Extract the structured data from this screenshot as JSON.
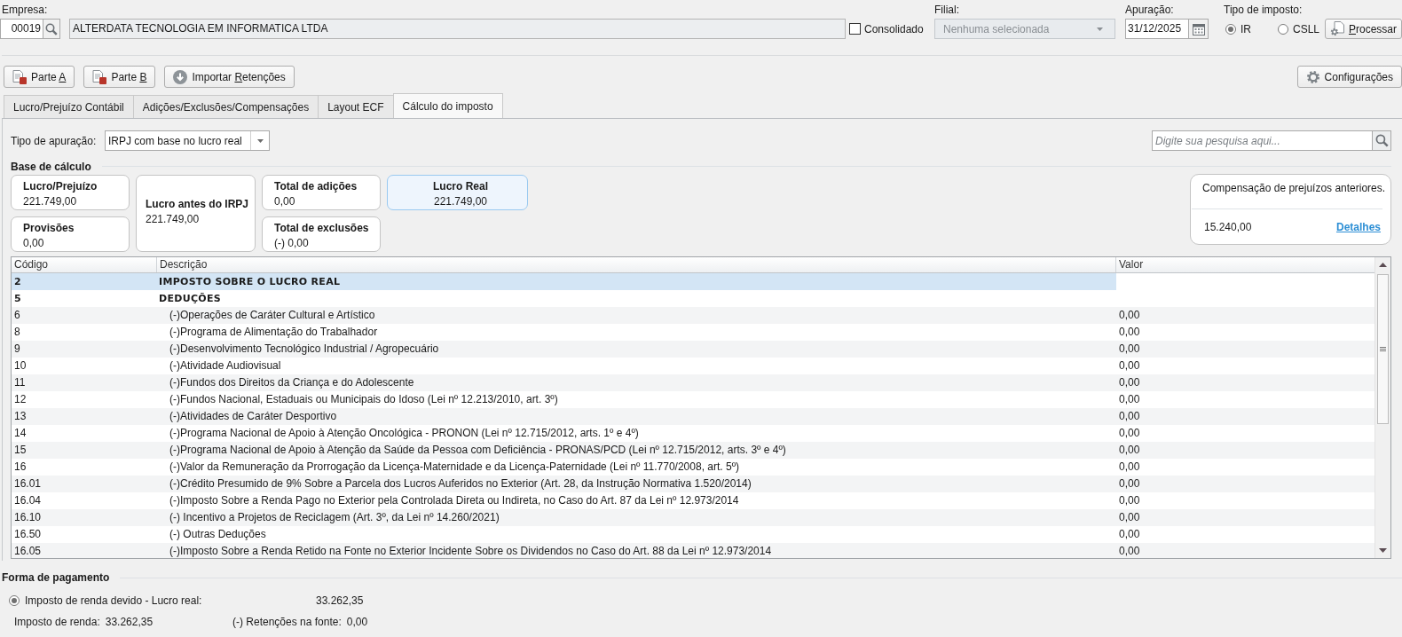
{
  "header": {
    "company": {
      "label": "Empresa:",
      "code": "00019",
      "name": "ALTERDATA TECNOLOGIA EM INFORMATICA LTDA"
    },
    "consolidated": {
      "label": "Consolidado",
      "checked": false
    },
    "branch": {
      "label": "Filial:",
      "value": "Nenhuma selecionada",
      "disabled": true
    },
    "period": {
      "label": "Apuração:",
      "value": "31/12/2025"
    },
    "tax_type": {
      "label": "Tipo de imposto:",
      "options": [
        {
          "label": "IR",
          "selected": true
        },
        {
          "label": "CSLL",
          "selected": false
        }
      ]
    },
    "process_button": {
      "mnemonic": "P",
      "post": "rocessar"
    }
  },
  "toolbar": {
    "buttons": [
      {
        "kind": "report",
        "pre": "Parte ",
        "mnemonic": "A"
      },
      {
        "kind": "report",
        "pre": "Parte ",
        "mnemonic": "B"
      },
      {
        "kind": "import",
        "pre": "Importar ",
        "mnemonic": "R",
        "post": "etenções"
      }
    ],
    "settings_button": {
      "label": "Configurações"
    }
  },
  "tabs": [
    {
      "label": "Lucro/Prejuízo Contábil",
      "selected": false
    },
    {
      "label": "Adições/Exclusões/Compensações",
      "selected": false
    },
    {
      "label": "Layout ECF",
      "selected": false
    },
    {
      "label": "Cálculo do imposto",
      "selected": true
    }
  ],
  "calculation": {
    "type_field": {
      "label": "Tipo de apuração:",
      "value": "IRPJ com base no lucro real"
    },
    "search": {
      "placeholder": "Digite sua pesquisa aqui..."
    },
    "base": {
      "title": "Base de cálculo",
      "cards": [
        {
          "kind": "normal",
          "label": "Lucro/Prejuízo",
          "value": "221.749,00"
        },
        {
          "kind": "normal",
          "label": "Provisões",
          "value": "0,00"
        },
        {
          "kind": "tall",
          "label": "Lucro antes do IRPJ",
          "value": "221.749,00"
        },
        {
          "kind": "normal",
          "label": "Total de adições",
          "value": "0,00"
        },
        {
          "kind": "normal",
          "label": "Total de exclusões",
          "value": "(-) 0,00"
        },
        {
          "kind": "featured",
          "label": "Lucro Real",
          "value": "221.749,00"
        }
      ],
      "compensation": {
        "title": "Compensação de prejuízos anteriores.",
        "value": "15.240,00",
        "link": "Detalhes"
      }
    },
    "table": {
      "columns": [
        "Código",
        "Descrição",
        "Valor"
      ],
      "rows": [
        {
          "code": "2",
          "description": "IMPOSTO SOBRE O LUCRO REAL",
          "selected": true
        },
        {
          "code": "5",
          "description": "DEDUÇÕES",
          "selected": false,
          "children": [
            {
              "code": "6",
              "description": "(-)Operações de Caráter Cultural e Artístico",
              "value": "0,00",
              "selected": false
            },
            {
              "code": "8",
              "description": "(-)Programa de Alimentação do Trabalhador",
              "value": "0,00",
              "selected": false
            },
            {
              "code": "9",
              "description": "(-)Desenvolvimento Tecnológico Industrial / Agropecuário",
              "value": "0,00",
              "selected": false
            },
            {
              "code": "10",
              "description": "(-)Atividade Audiovisual",
              "value": "0,00",
              "selected": false
            },
            {
              "code": "11",
              "description": "(-)Fundos dos Direitos da Criança e do Adolescente",
              "value": "0,00",
              "selected": false
            },
            {
              "code": "12",
              "description": "(-)Fundos Nacional, Estaduais ou Municipais do Idoso (Lei nº 12.213/2010, art. 3º)",
              "value": "0,00",
              "selected": false
            },
            {
              "code": "13",
              "description": "(-)Atividades de Caráter Desportivo",
              "value": "0,00",
              "selected": false
            },
            {
              "code": "14",
              "description": "(-)Programa Nacional de Apoio à Atenção Oncológica - PRONON (Lei nº 12.715/2012, arts. 1º e 4º)",
              "value": "0,00",
              "selected": false
            },
            {
              "code": "15",
              "description": "(-)Programa Nacional de Apoio à Atenção da Saúde da Pessoa com Deficiência - PRONAS/PCD (Lei nº 12.715/2012, arts. 3º e 4º)",
              "value": "0,00",
              "selected": false
            },
            {
              "code": "16",
              "description": "(-)Valor da Remuneração da Prorrogação da Licença-Maternidade e da Licença-Paternidade (Lei nº 11.770/2008, art. 5º)",
              "value": "0,00",
              "selected": false
            },
            {
              "code": "16.01",
              "description": "(-)Crédito Presumido de 9% Sobre a Parcela dos Lucros Auferidos no Exterior (Art. 28, da Instrução Normativa 1.520/2014)",
              "value": "0,00",
              "selected": false
            },
            {
              "code": "16.04",
              "description": "(-)Imposto Sobre a Renda Pago no Exterior pela Controlada Direta ou Indireta, no Caso do Art. 87 da Lei nº 12.973/2014",
              "value": "0,00",
              "selected": false
            },
            {
              "code": "16.10",
              "description": "(-) Incentivo a Projetos de Reciclagem (Art. 3º, da Lei nº 14.260/2021)",
              "value": "0,00",
              "selected": false
            },
            {
              "code": "16.50",
              "description": "(-) Outras Deduções",
              "value": "0,00",
              "selected": false
            },
            {
              "code": "16.05",
              "description": "(-)Imposto Sobre a Renda Retido na Fonte no Exterior Incidente Sobre os Dividendos no Caso do Art. 88 da Lei nº 12.973/2014",
              "value": "0,00",
              "selected": false
            }
          ]
        }
      ]
    }
  },
  "payment": {
    "title": "Forma de pagamento",
    "option": {
      "label": "Imposto de renda devido - Lucro real:",
      "value": "33.262,35",
      "selected": true
    },
    "fields": [
      {
        "label": "Imposto de renda:",
        "value": "33.262,35"
      },
      {
        "label": "(-) Retenções na fonte:",
        "value": "0,00"
      }
    ]
  }
}
